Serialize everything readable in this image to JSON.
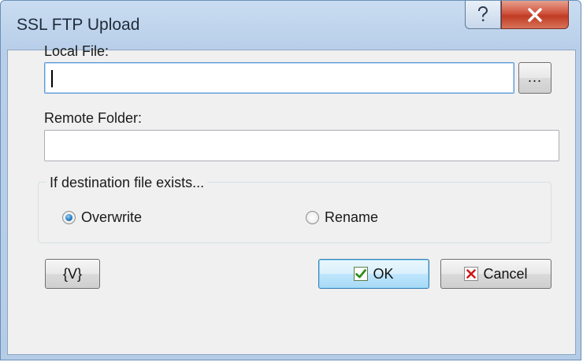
{
  "window": {
    "title": "SSL FTP Upload",
    "help_icon": "question-mark-icon",
    "close_icon": "close-x-icon"
  },
  "form": {
    "local_file_label": "Local File:",
    "local_file_value": "",
    "browse_label": "...",
    "remote_folder_label": "Remote Folder:",
    "remote_folder_value": ""
  },
  "destination_group": {
    "legend": "If destination file exists...",
    "options": [
      {
        "label": "Overwrite",
        "selected": true
      },
      {
        "label": "Rename",
        "selected": false
      }
    ]
  },
  "buttons": {
    "variables_label": "{V}",
    "ok_label": "OK",
    "cancel_label": "Cancel"
  },
  "colors": {
    "title_bar": "#c9dcf1",
    "close_button": "#c13b23",
    "ok_check": "#2e8b1e",
    "cancel_x": "#d01818",
    "focus_border": "#5c9ad6"
  }
}
